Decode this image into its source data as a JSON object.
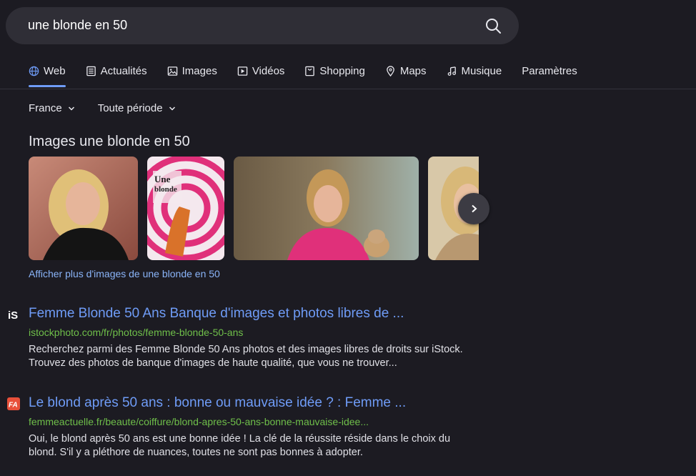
{
  "search": {
    "query": "une blonde en 50"
  },
  "tabs": [
    {
      "label": "Web",
      "icon": "globe-icon",
      "active": true
    },
    {
      "label": "Actualités",
      "icon": "news-icon"
    },
    {
      "label": "Images",
      "icon": "image-icon"
    },
    {
      "label": "Vidéos",
      "icon": "video-icon"
    },
    {
      "label": "Shopping",
      "icon": "shopping-icon"
    },
    {
      "label": "Maps",
      "icon": "map-pin-icon"
    },
    {
      "label": "Musique",
      "icon": "music-icon"
    },
    {
      "label": "Paramètres",
      "icon": ""
    }
  ],
  "filters": {
    "region": "France",
    "period": "Toute période"
  },
  "images": {
    "heading": "Images une blonde en 50",
    "more_link": "Afficher plus d'images de une blonde en 50"
  },
  "results": [
    {
      "favicon_text": "iS",
      "title": "Femme Blonde 50 Ans Banque d'images et photos libres de ...",
      "url": "istockphoto.com/fr/photos/femme-blonde-50-ans",
      "snippet": "Recherchez parmi des Femme Blonde 50 Ans photos et des images libres de droits sur iStock. Trouvez des photos de banque d'images de haute qualité, que vous ne trouver..."
    },
    {
      "favicon_text": "FA",
      "title": "Le blond après 50 ans : bonne ou mauvaise idée ? : Femme ...",
      "url": "femmeactuelle.fr/beaute/coiffure/blond-apres-50-ans-bonne-mauvaise-idee...",
      "snippet": "Oui, le blond après 50 ans est une bonne idée ! La clé de la réussite réside dans le choix du blond. S'il y a pléthore de nuances, toutes ne sont pas bonnes à adopter."
    }
  ],
  "colors": {
    "link": "#6f9cf7",
    "url": "#6fbf4a",
    "background": "#1c1b22"
  }
}
